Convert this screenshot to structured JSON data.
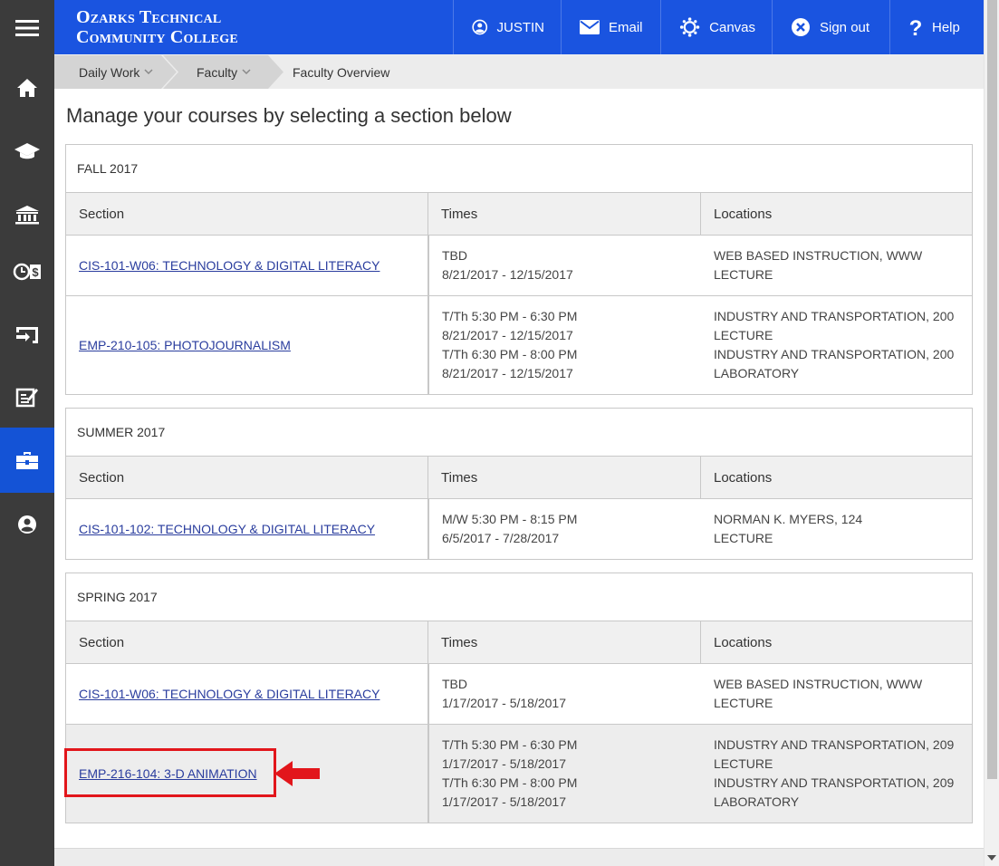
{
  "header": {
    "logo_line1": "Ozarks Technical",
    "logo_line2": "Community College",
    "nav": [
      {
        "label": "JUSTIN",
        "icon": "user-circle-icon"
      },
      {
        "label": "Email",
        "icon": "envelope-icon"
      },
      {
        "label": "Canvas",
        "icon": "canvas-icon"
      },
      {
        "label": "Sign out",
        "icon": "close-circle-icon"
      },
      {
        "label": "Help",
        "icon": "question-icon"
      }
    ]
  },
  "sidebar": {
    "items": [
      {
        "icon": "menu-icon"
      },
      {
        "icon": "home-icon"
      },
      {
        "icon": "graduation-cap-icon"
      },
      {
        "icon": "bank-icon"
      },
      {
        "icon": "finance-clock-icon"
      },
      {
        "icon": "exit-icon"
      },
      {
        "icon": "edit-form-icon"
      },
      {
        "icon": "briefcase-icon",
        "active": true
      },
      {
        "icon": "user-circle-icon"
      }
    ]
  },
  "breadcrumb": {
    "items": [
      "Daily Work",
      "Faculty",
      "Faculty Overview"
    ]
  },
  "main": {
    "title": "Manage your courses by selecting a section below",
    "columns": {
      "section": "Section",
      "times": "Times",
      "locations": "Locations"
    },
    "terms": [
      {
        "name": "FALL 2017",
        "rows": [
          {
            "section": "CIS-101-W06: TECHNOLOGY & DIGITAL LITERACY",
            "times": [
              "TBD",
              "8/21/2017 - 12/15/2017"
            ],
            "locations": [
              "WEB BASED INSTRUCTION, WWW",
              "LECTURE"
            ]
          },
          {
            "section": "EMP-210-105: PHOTOJOURNALISM",
            "times": [
              "T/Th 5:30 PM - 6:30 PM",
              "8/21/2017 - 12/15/2017",
              "T/Th 6:30 PM - 8:00 PM",
              "8/21/2017 - 12/15/2017"
            ],
            "locations": [
              "INDUSTRY AND TRANSPORTATION, 200",
              "LECTURE",
              "INDUSTRY AND TRANSPORTATION, 200",
              "LABORATORY"
            ]
          }
        ]
      },
      {
        "name": "SUMMER 2017",
        "rows": [
          {
            "section": "CIS-101-102: TECHNOLOGY & DIGITAL LITERACY",
            "times": [
              "M/W 5:30 PM - 8:15 PM",
              "6/5/2017 - 7/28/2017"
            ],
            "locations": [
              "NORMAN K. MYERS, 124",
              "LECTURE"
            ]
          }
        ]
      },
      {
        "name": "SPRING 2017",
        "rows": [
          {
            "section": "CIS-101-W06: TECHNOLOGY & DIGITAL LITERACY",
            "times": [
              "TBD",
              "1/17/2017 - 5/18/2017"
            ],
            "locations": [
              "WEB BASED INSTRUCTION, WWW",
              "LECTURE"
            ]
          },
          {
            "section": "EMP-216-104: 3-D ANIMATION",
            "times": [
              "T/Th 5:30 PM - 6:30 PM",
              "1/17/2017 - 5/18/2017",
              "T/Th 6:30 PM - 8:00 PM",
              "1/17/2017 - 5/18/2017"
            ],
            "locations": [
              "INDUSTRY AND TRANSPORTATION, 209",
              "LECTURE",
              "INDUSTRY AND TRANSPORTATION, 209",
              "LABORATORY"
            ],
            "highlighted": true
          }
        ]
      }
    ]
  },
  "colors": {
    "header_blue": "#1a54e0",
    "sidebar_dark": "#3b3b3b",
    "sidebar_active": "#1453d6",
    "link": "#2a3d9e",
    "annotation_red": "#e2161b"
  }
}
